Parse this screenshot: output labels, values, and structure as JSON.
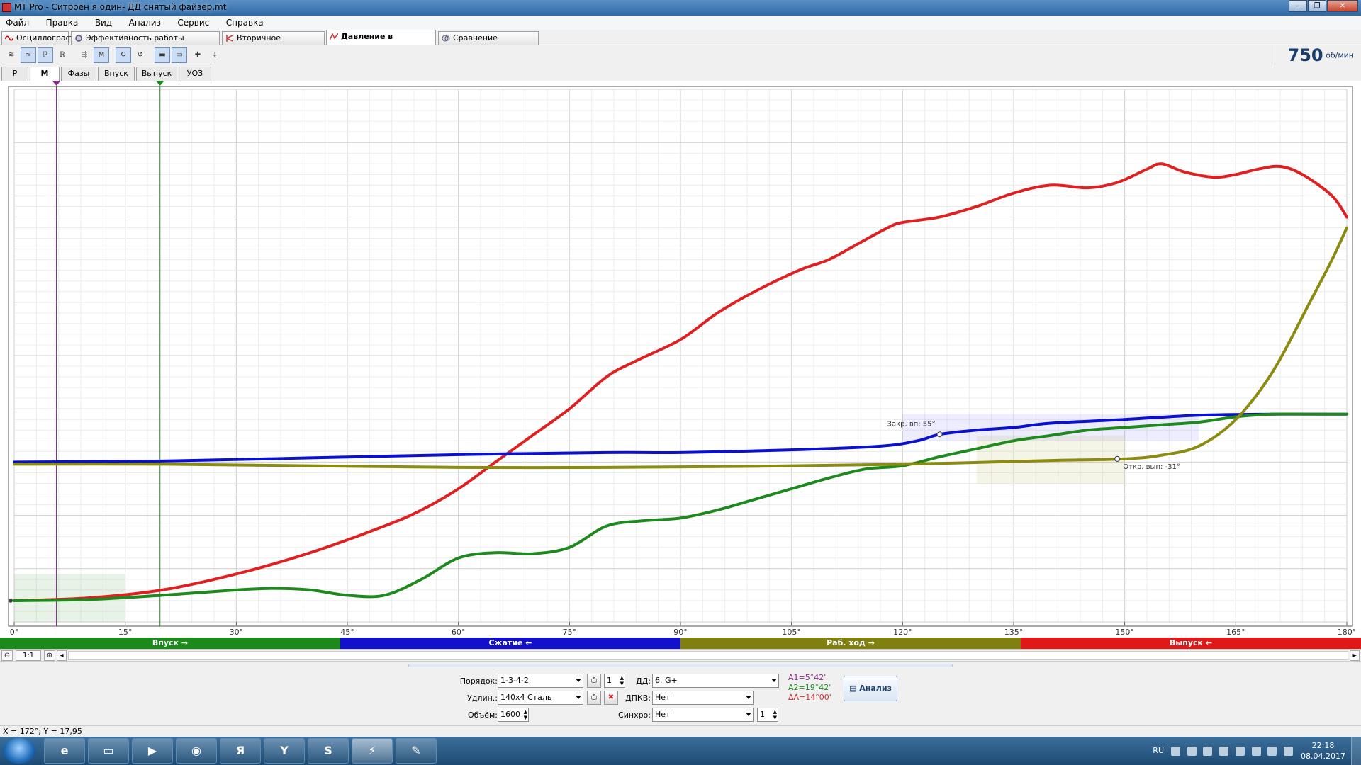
{
  "window": {
    "title": "MT Pro - Ситроен я один- ДД снятый файзер.mt"
  },
  "menu": [
    "Файл",
    "Правка",
    "Вид",
    "Анализ",
    "Сервис",
    "Справка"
  ],
  "tabs": [
    "Осциллограф",
    "Эффективность работы цилиндров",
    "Вторичное напряжение",
    "Давление в цилиндре",
    "Сравнение цилиндров"
  ],
  "active_tab": "Давление в цилиндре",
  "rpm": {
    "value": "750",
    "unit": "об/мин"
  },
  "subtabs": [
    "P",
    "M",
    "Фазы",
    "Впуск",
    "Выпуск",
    "УОЗ"
  ],
  "active_subtab": "M",
  "chart_data": {
    "type": "line",
    "x_ticks": [
      "0°",
      "15°",
      "30°",
      "45°",
      "60°",
      "75°",
      "90°",
      "105°",
      "120°",
      "135°",
      "150°",
      "165°",
      "180°"
    ],
    "xlim": [
      0,
      180
    ],
    "ylim": [
      0,
      100
    ],
    "grid": true,
    "series": [
      {
        "color": "#e02020",
        "points": [
          [
            0,
            4
          ],
          [
            10,
            4.5
          ],
          [
            20,
            6
          ],
          [
            30,
            9
          ],
          [
            40,
            13
          ],
          [
            50,
            18
          ],
          [
            55,
            21
          ],
          [
            60,
            25
          ],
          [
            65,
            30
          ],
          [
            70,
            35
          ],
          [
            75,
            40
          ],
          [
            80,
            46
          ],
          [
            84,
            49
          ],
          [
            90,
            53
          ],
          [
            95,
            58
          ],
          [
            100,
            62
          ],
          [
            106,
            66
          ],
          [
            110,
            68
          ],
          [
            114,
            71
          ],
          [
            118,
            74
          ],
          [
            120,
            75
          ],
          [
            125,
            76
          ],
          [
            130,
            78
          ],
          [
            135,
            80.5
          ],
          [
            140,
            82
          ],
          [
            145,
            81.5
          ],
          [
            149,
            82.5
          ],
          [
            153,
            85
          ],
          [
            155,
            86
          ],
          [
            158,
            84.5
          ],
          [
            162,
            83.5
          ],
          [
            165,
            84
          ],
          [
            168,
            85
          ],
          [
            171,
            85.5
          ],
          [
            174,
            84
          ],
          [
            178,
            80
          ],
          [
            180,
            76
          ]
        ]
      },
      {
        "color": "#0a10d0",
        "points": [
          [
            0,
            30
          ],
          [
            20,
            30.2
          ],
          [
            40,
            30.8
          ],
          [
            60,
            31.4
          ],
          [
            80,
            31.8
          ],
          [
            90,
            31.8
          ],
          [
            105,
            32.3
          ],
          [
            117,
            33
          ],
          [
            122,
            34
          ],
          [
            125,
            35.2
          ],
          [
            130,
            36
          ],
          [
            135,
            36.5
          ],
          [
            140,
            37.3
          ],
          [
            150,
            38
          ],
          [
            160,
            38.8
          ],
          [
            170,
            39
          ],
          [
            180,
            39
          ]
        ]
      },
      {
        "color": "#1e8a1e",
        "points": [
          [
            0,
            4
          ],
          [
            10,
            4.2
          ],
          [
            20,
            5
          ],
          [
            30,
            6
          ],
          [
            35,
            6.3
          ],
          [
            40,
            6
          ],
          [
            45,
            5
          ],
          [
            50,
            5
          ],
          [
            55,
            8
          ],
          [
            60,
            12
          ],
          [
            65,
            13
          ],
          [
            70,
            12.8
          ],
          [
            75,
            14
          ],
          [
            80,
            18
          ],
          [
            85,
            19
          ],
          [
            90,
            19.5
          ],
          [
            95,
            21
          ],
          [
            100,
            23
          ],
          [
            105,
            25
          ],
          [
            110,
            27
          ],
          [
            115,
            28.7
          ],
          [
            120,
            29.3
          ],
          [
            125,
            31
          ],
          [
            130,
            32.5
          ],
          [
            135,
            34
          ],
          [
            140,
            35
          ],
          [
            145,
            36
          ],
          [
            150,
            36.5
          ],
          [
            155,
            37
          ],
          [
            160,
            37.5
          ],
          [
            165,
            38.5
          ],
          [
            170,
            39
          ],
          [
            175,
            39
          ],
          [
            180,
            39
          ]
        ]
      },
      {
        "color": "#8b8b10",
        "points": [
          [
            0,
            29.6
          ],
          [
            20,
            29.6
          ],
          [
            40,
            29.3
          ],
          [
            60,
            29.0
          ],
          [
            80,
            29
          ],
          [
            100,
            29.2
          ],
          [
            120,
            29.6
          ],
          [
            140,
            30.3
          ],
          [
            150,
            30.6
          ],
          [
            155,
            31.3
          ],
          [
            160,
            33
          ],
          [
            165,
            38
          ],
          [
            170,
            47
          ],
          [
            175,
            60
          ],
          [
            178,
            68
          ],
          [
            180,
            74
          ]
        ]
      }
    ],
    "annotations": [
      {
        "text": "Закр. вп: 55°",
        "x": 125,
        "y": 35.2
      },
      {
        "text": "Откр. вып: -31°",
        "x": 149,
        "y": 30.6
      }
    ]
  },
  "phases": [
    {
      "label": "Впуск",
      "arrow": "→",
      "color": "#1b8a1b"
    },
    {
      "label": "Сжатие",
      "arrow": "←",
      "color": "#1111cc"
    },
    {
      "label": "Раб. ход",
      "arrow": "→",
      "color": "#808010"
    },
    {
      "label": "Выпуск",
      "arrow": "←",
      "color": "#e01818"
    }
  ],
  "zoom": {
    "ratio": "1:1"
  },
  "controls": {
    "order": {
      "label": "Порядок:",
      "value": "1-3-4-2"
    },
    "cyl": {
      "value": "1"
    },
    "dd": {
      "label": "ДД:",
      "value": "6. G+"
    },
    "extension": {
      "label": "Удлин.:",
      "value": "140x4 Сталь"
    },
    "dpkv": {
      "label": "ДПКВ:",
      "value": "Нет"
    },
    "volume": {
      "label": "Объём:",
      "value": "1600"
    },
    "sync": {
      "label": "Синхро:",
      "value": "Нет"
    },
    "sync_num": {
      "value": "1"
    },
    "analyze_label": "Анализ"
  },
  "angles": {
    "a1": "A1=5°42'",
    "a2": "A2=19°42'",
    "da": "ΔA=14°00'"
  },
  "status": "X = 172°; Y = 17,95",
  "tray": {
    "lang": "RU",
    "time": "22:18",
    "date": "08.04.2017"
  }
}
